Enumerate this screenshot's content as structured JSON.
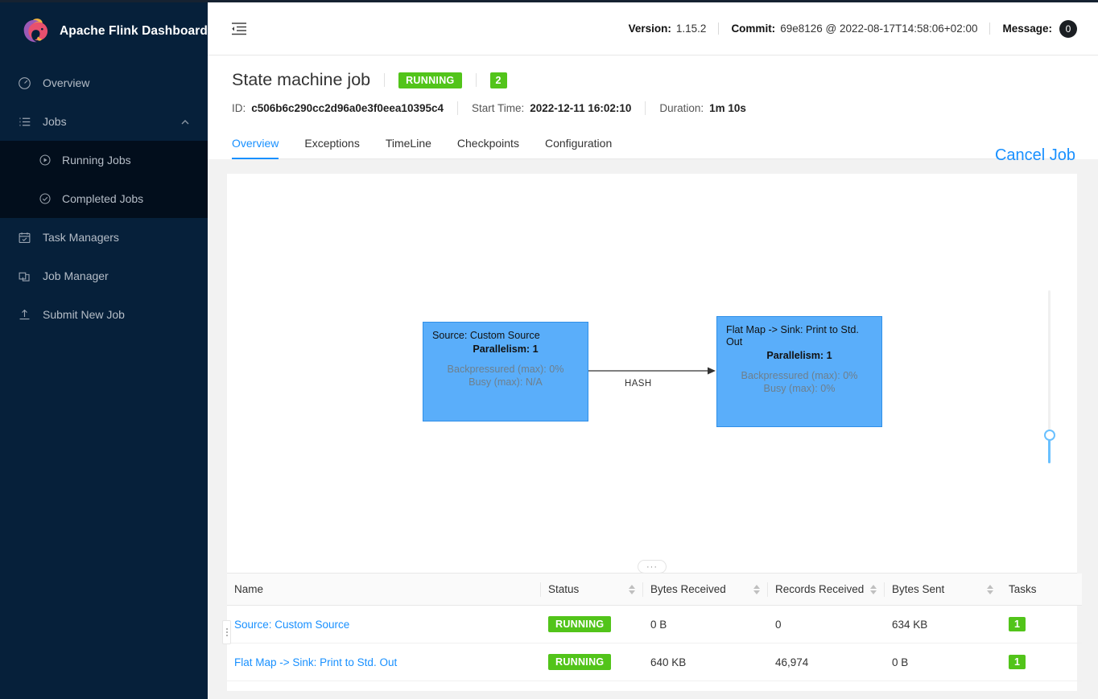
{
  "sidebar": {
    "brand_title": "Apache Flink Dashboard",
    "items": [
      {
        "label": "Overview",
        "icon": "dashboard-icon"
      },
      {
        "label": "Jobs",
        "icon": "list-icon"
      },
      {
        "label": "Task Managers",
        "icon": "calendar-check-icon"
      },
      {
        "label": "Job Manager",
        "icon": "cluster-icon"
      },
      {
        "label": "Submit New Job",
        "icon": "upload-icon"
      }
    ],
    "submenu": [
      {
        "label": "Running Jobs",
        "icon": "play-circle-icon"
      },
      {
        "label": "Completed Jobs",
        "icon": "check-circle-icon"
      }
    ]
  },
  "topbar": {
    "fold_icon": "menu-fold-icon",
    "version_label": "Version:",
    "version_value": "1.15.2",
    "commit_label": "Commit:",
    "commit_value": "69e8126 @ 2022-08-17T14:58:06+02:00",
    "message_label": "Message:",
    "message_count": "0"
  },
  "job": {
    "title": "State machine job",
    "status": "RUNNING",
    "task_count": "2",
    "id_label": "ID:",
    "id_value": "c506b6c290cc2d96a0e3f0eea10395c4",
    "start_label": "Start Time:",
    "start_value": "2022-12-11 16:02:10",
    "duration_label": "Duration:",
    "duration_value": "1m 10s",
    "cancel_label": "Cancel Job"
  },
  "tabs": [
    {
      "label": "Overview",
      "active": true
    },
    {
      "label": "Exceptions",
      "active": false
    },
    {
      "label": "TimeLine",
      "active": false
    },
    {
      "label": "Checkpoints",
      "active": false
    },
    {
      "label": "Configuration",
      "active": false
    }
  ],
  "graph": {
    "node_color": "#5aaefa",
    "edge_label": "HASH",
    "drag_handle": "···",
    "nodes": [
      {
        "name": "Source: Custom Source",
        "parallelism": "Parallelism: 1",
        "backpressured": "Backpressured (max): 0%",
        "busy": "Busy (max): N/A"
      },
      {
        "name": "Flat Map -> Sink: Print to Std. Out",
        "parallelism": "Parallelism: 1",
        "backpressured": "Backpressured (max): 0%",
        "busy": "Busy (max): 0%"
      }
    ]
  },
  "table": {
    "columns": [
      {
        "label": "Name",
        "sortable": false
      },
      {
        "label": "Status",
        "sortable": true
      },
      {
        "label": "Bytes Received",
        "sortable": true
      },
      {
        "label": "Records Received",
        "sortable": true
      },
      {
        "label": "Bytes Sent",
        "sortable": true
      },
      {
        "label": "Tasks",
        "sortable": false
      }
    ],
    "rows": [
      {
        "name": "Source: Custom Source",
        "status": "RUNNING",
        "bytes_received": "0 B",
        "records_received": "0",
        "bytes_sent": "634 KB",
        "tasks": "1"
      },
      {
        "name": "Flat Map -> Sink: Print to Std. Out",
        "status": "RUNNING",
        "bytes_received": "640 KB",
        "records_received": "46,974",
        "bytes_sent": "0 B",
        "tasks": "1"
      }
    ]
  },
  "colors": {
    "accent": "#1890ff",
    "success": "#52c41a",
    "sidebar_bg": "#06203a",
    "node_fill": "#5aaefa"
  }
}
